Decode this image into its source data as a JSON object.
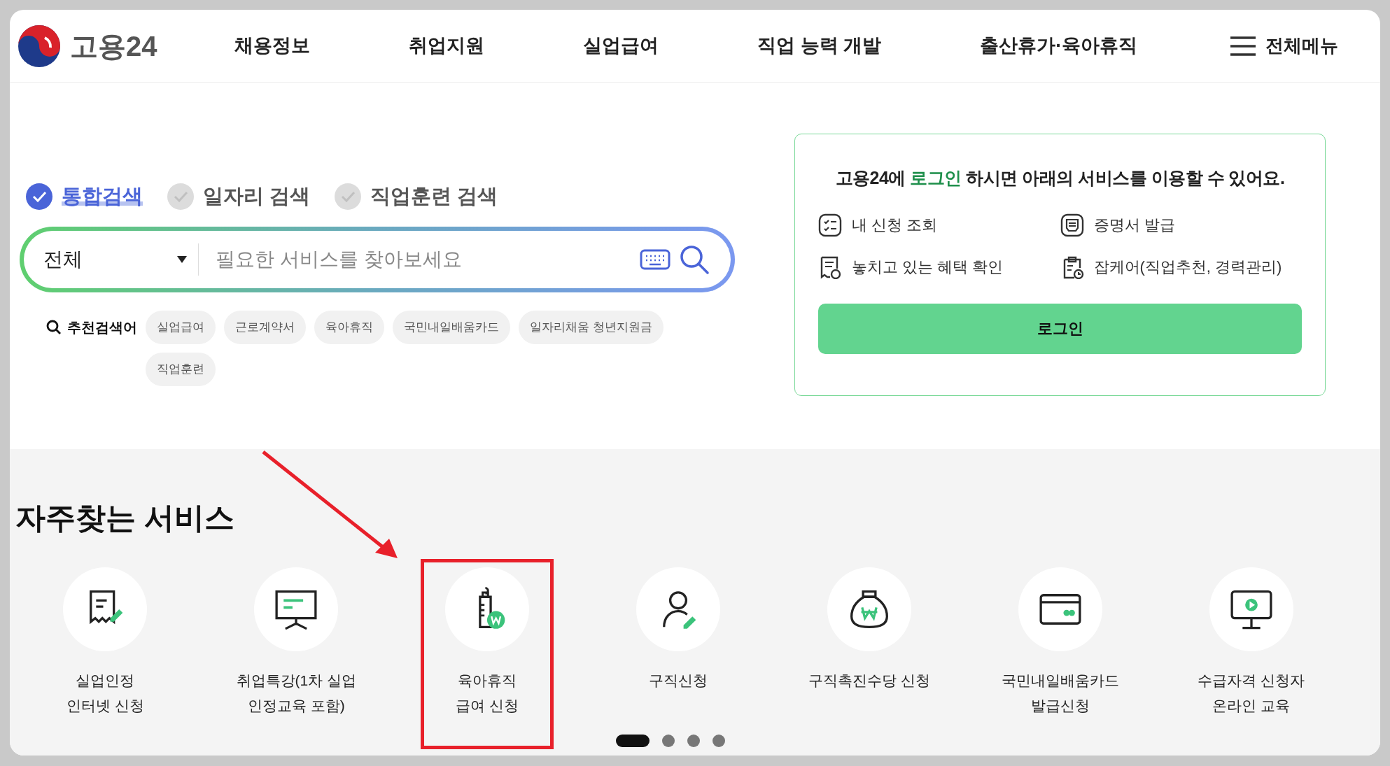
{
  "header": {
    "logo_text": "고용24",
    "nav": [
      "채용정보",
      "취업지원",
      "실업급여",
      "직업 능력 개발",
      "출산휴가·육아휴직"
    ],
    "menu_label": "전체메뉴"
  },
  "search": {
    "tabs": [
      {
        "label": "통합검색",
        "selected": true
      },
      {
        "label": "일자리 검색",
        "selected": false
      },
      {
        "label": "직업훈련 검색",
        "selected": false
      }
    ],
    "category": "전체",
    "placeholder": "필요한 서비스를 찾아보세요",
    "recommended_label": "추천검색어",
    "recommended": [
      "실업급여",
      "근로계약서",
      "육아휴직",
      "국민내일배움카드",
      "일자리채움 청년지원금",
      "직업훈련"
    ]
  },
  "login_box": {
    "message": "고용24에 **로그인** 하시면 아래의 서비스를 이용할 수 있어요.",
    "features": [
      "내 신청 조회",
      "증명서 발급",
      "놓치고 있는 혜택 확인",
      "잡케어(직업추천, 경력관리)"
    ],
    "button": "로그인"
  },
  "services": {
    "title": "자주찾는 서비스",
    "items": [
      {
        "lines": [
          "실업인정",
          "인터넷 신청"
        ],
        "highlighted": false
      },
      {
        "lines": [
          "취업특강(1차 실업",
          "인정교육 포함)"
        ],
        "highlighted": false
      },
      {
        "lines": [
          "육아휴직",
          "급여 신청"
        ],
        "highlighted": true
      },
      {
        "lines": [
          "구직신청"
        ],
        "highlighted": false
      },
      {
        "lines": [
          "구직촉진수당 신청"
        ],
        "highlighted": false
      },
      {
        "lines": [
          "국민내일배움카드",
          "발급신청"
        ],
        "highlighted": false
      },
      {
        "lines": [
          "수급자격 신청자",
          "온라인 교육"
        ],
        "highlighted": false
      }
    ],
    "dots": [
      {
        "selected": true
      },
      {
        "selected": false
      },
      {
        "selected": false
      },
      {
        "selected": false
      }
    ]
  }
}
